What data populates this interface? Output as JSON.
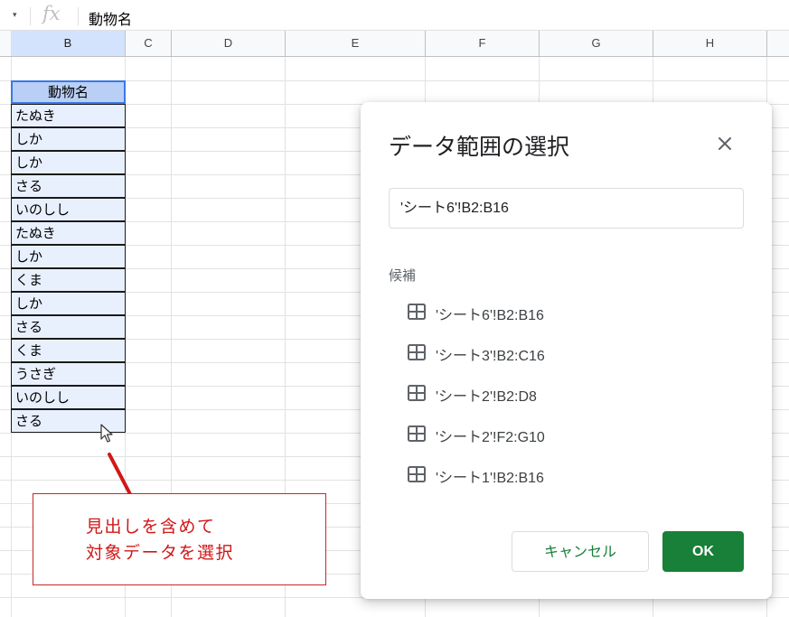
{
  "formula_bar": {
    "fx_label": "fx",
    "content": "動物名"
  },
  "columns": [
    "B",
    "C",
    "D",
    "E",
    "F",
    "G",
    "H"
  ],
  "table": {
    "header": "動物名",
    "rows": [
      "たぬき",
      "しか",
      "しか",
      "さる",
      "いのしし",
      "たぬき",
      "しか",
      "くま",
      "しか",
      "さる",
      "くま",
      "うさぎ",
      "いのしし",
      "さる"
    ]
  },
  "callout": {
    "line1": "見出しを含めて",
    "line2": "対象データを選択",
    "color": "#d01818"
  },
  "dialog": {
    "title": "データ範囲の選択",
    "range_value": "'シート6'!B2:B16",
    "suggestions_label": "候補",
    "suggestions": [
      "'シート6'!B2:B16",
      "'シート3'!B2:C16",
      "'シート2'!B2:D8",
      "'シート2'!F2:G10",
      "'シート1'!B2:B16"
    ],
    "cancel_label": "キャンセル",
    "ok_label": "OK",
    "accent_color": "#188038"
  }
}
